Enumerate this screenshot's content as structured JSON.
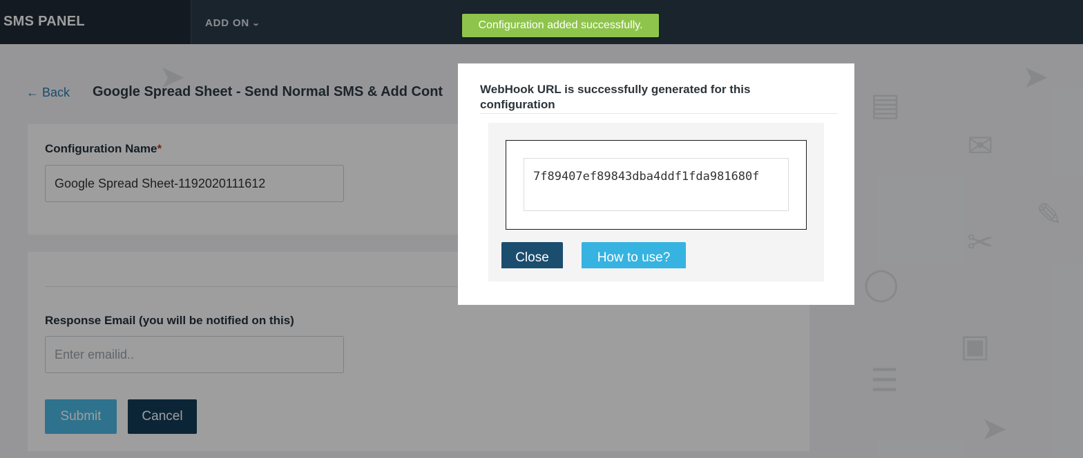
{
  "header": {
    "brand": "SMS PANEL",
    "nav_addon": "ADD ON",
    "nav_addon_icon": "chevron-down-icon"
  },
  "toast": {
    "message": "Configuration added successfully.",
    "color": "#8ec44b"
  },
  "page": {
    "back_label": "← Back",
    "title": "Google Spread Sheet - Send Normal SMS & Add Cont",
    "config_name_label": "Configuration Name",
    "required_mark": "*",
    "config_name_value": "Google Spread Sheet-1192020111612",
    "response_email_label": "Response Email (you will be notified on this)",
    "response_email_placeholder": "Enter emailid..",
    "submit_label": "Submit",
    "cancel_label": "Cancel"
  },
  "modal": {
    "title": "WebHook URL is successfully generated for this configuration",
    "webhook_url": "7f89407ef89843dba4ddf1fda981680f",
    "close_label": "Close",
    "howto_label": "How to use?"
  },
  "colors": {
    "header_bg": "#2b3a4a",
    "brand_bg": "#1f2a37",
    "link": "#2a7ab0",
    "submit": "#4bb8e4",
    "cancel": "#123d5a",
    "close": "#1b4d6e",
    "howto": "#36b3e0"
  }
}
